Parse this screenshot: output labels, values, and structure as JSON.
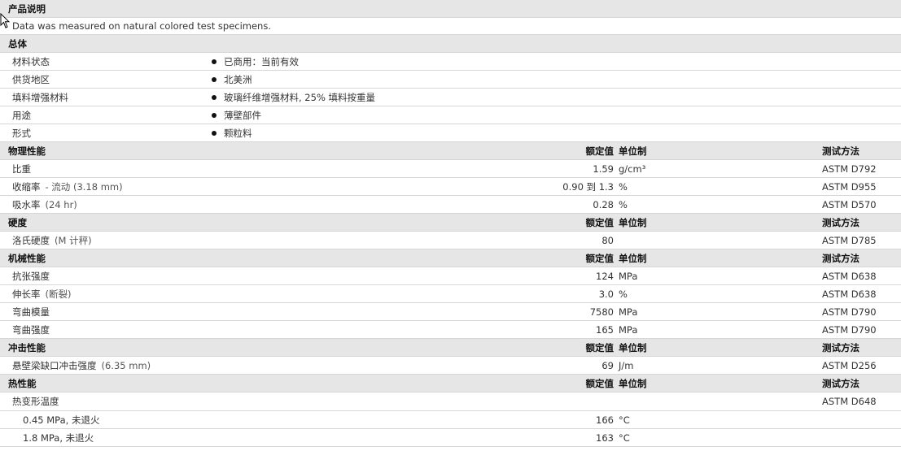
{
  "section_desc": {
    "title": "产品说明",
    "note": "Data was measured on natural colored test specimens."
  },
  "general": {
    "title": "总体",
    "rows": [
      {
        "label": "材料状态",
        "value": "已商用：当前有效"
      },
      {
        "label": "供货地区",
        "value": "北美洲"
      },
      {
        "label": "填料增强材料",
        "value": "玻璃纤维增强材料, 25% 填料按重量"
      },
      {
        "label": "用途",
        "value": "薄壁部件"
      },
      {
        "label": "形式",
        "value": "颗粒料"
      }
    ]
  },
  "col_headers": {
    "nominal": "额定值",
    "unit": "单位制",
    "test": "测试方法"
  },
  "physical": {
    "title": "物理性能",
    "rows": [
      {
        "prop": "比重",
        "cond": "",
        "nominal": "1.59",
        "unit": "g/cm³",
        "test": "ASTM D792"
      },
      {
        "prop": "收缩率",
        "cond": "- 流动 (3.18 mm)",
        "nominal": "0.90 到 1.3",
        "unit": "%",
        "test": "ASTM D955"
      },
      {
        "prop": "吸水率",
        "cond": "(24 hr)",
        "nominal": "0.28",
        "unit": "%",
        "test": "ASTM D570"
      }
    ]
  },
  "hardness": {
    "title": "硬度",
    "rows": [
      {
        "prop": "洛氏硬度",
        "cond": "(M 计秤)",
        "nominal": "80",
        "unit": "",
        "test": "ASTM D785"
      }
    ]
  },
  "mechanical": {
    "title": "机械性能",
    "rows": [
      {
        "prop": "抗张强度",
        "cond": "",
        "nominal": "124",
        "unit": "MPa",
        "test": "ASTM D638"
      },
      {
        "prop": "伸长率",
        "cond": "(断裂)",
        "nominal": "3.0",
        "unit": "%",
        "test": "ASTM D638"
      },
      {
        "prop": "弯曲模量",
        "cond": "",
        "nominal": "7580",
        "unit": "MPa",
        "test": "ASTM D790"
      },
      {
        "prop": "弯曲强度",
        "cond": "",
        "nominal": "165",
        "unit": "MPa",
        "test": "ASTM D790"
      }
    ]
  },
  "impact": {
    "title": "冲击性能",
    "rows": [
      {
        "prop": "悬壁梁缺口冲击强度",
        "cond": "(6.35 mm)",
        "nominal": "69",
        "unit": "J/m",
        "test": "ASTM D256"
      }
    ]
  },
  "thermal": {
    "title": "热性能",
    "rows": [
      {
        "prop": "热变形温度",
        "cond": "",
        "nominal": "",
        "unit": "",
        "test": "ASTM D648",
        "sub": false
      },
      {
        "prop": "0.45 MPa, 未退火",
        "cond": "",
        "nominal": "166",
        "unit": "°C",
        "test": "",
        "sub": true
      },
      {
        "prop": "1.8 MPa, 未退火",
        "cond": "",
        "nominal": "163",
        "unit": "°C",
        "test": "",
        "sub": true
      }
    ]
  },
  "cursor": {
    "icon": "arrow-cursor-icon"
  }
}
